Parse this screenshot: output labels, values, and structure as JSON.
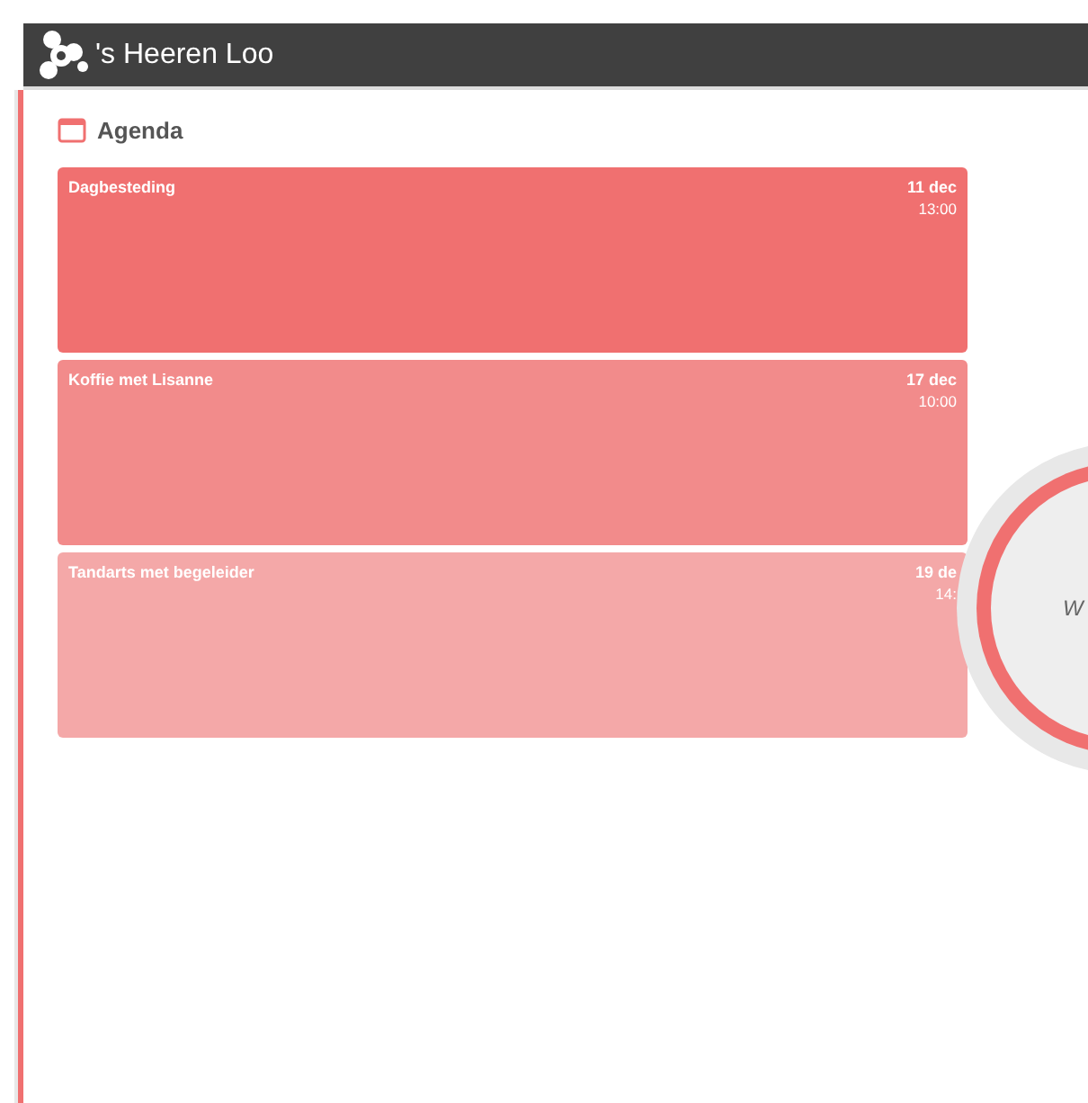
{
  "header": {
    "brand": "'s Heeren Loo"
  },
  "agenda": {
    "title": "Agenda",
    "items": [
      {
        "title": "Dagbesteding",
        "date": "11 dec",
        "time": "13:00",
        "color": "#f07070"
      },
      {
        "title": "Koffie met Lisanne",
        "date": "17 dec",
        "time": "10:00",
        "color": "#f28b8b"
      },
      {
        "title": "Tandarts met begeleider",
        "date": "19 de",
        "time": "14:",
        "color": "#f4a8a8"
      }
    ]
  },
  "avatar": {
    "label": "W"
  }
}
